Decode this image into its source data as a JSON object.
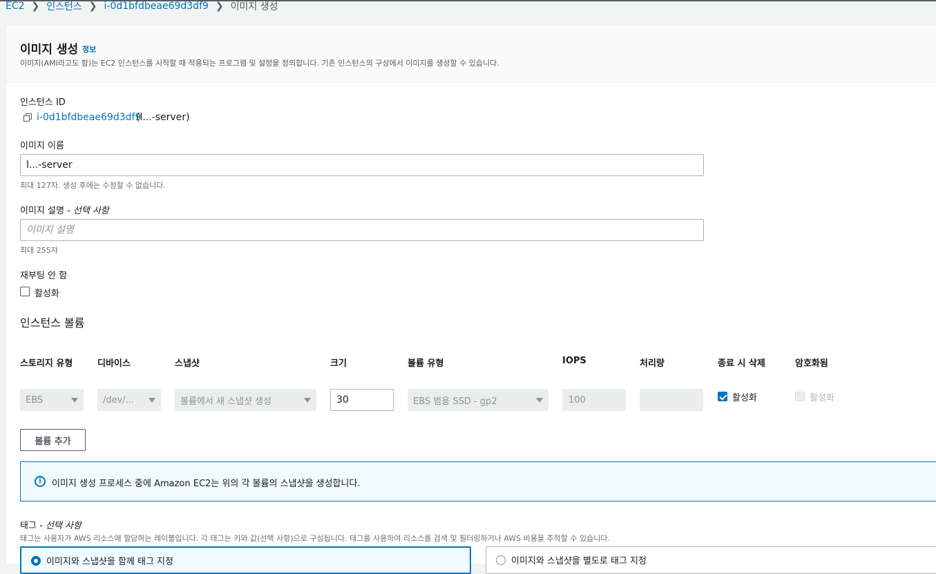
{
  "breadcrumb": {
    "items": [
      "EC2",
      "인스턴스",
      "i-0d1bfdbeae69d3df9"
    ],
    "current": "이미지 생성"
  },
  "header": {
    "title": "이미지 생성",
    "info_link": "정보",
    "description": "이미지(AMI라고도 함)는 EC2 인스턴스를 시작할 때 적용되는 프로그램 및 설정을 정의합니다. 기존 인스턴스의 구성에서 이미지를 생성할 수 있습니다."
  },
  "instance": {
    "label": "인스턴스 ID",
    "id": "i-0d1bfdbeae69d3df9",
    "name": "(l...-server)"
  },
  "image_name": {
    "label": "이미지 이름",
    "value": "l...-server",
    "hint": "최대 127자. 생성 후에는 수정할 수 없습니다."
  },
  "image_description": {
    "label": "이미지 설명",
    "optional": "- 선택 사항",
    "placeholder": "이미지 설명",
    "hint": "최대 255자"
  },
  "no_reboot": {
    "label": "재부팅 안 함",
    "checkbox_label": "활성화",
    "checked": false
  },
  "volumes": {
    "title": "인스턴스 볼륨",
    "columns": [
      "스토리지 유형",
      "디바이스",
      "스냅샷",
      "크기",
      "볼륨 유형",
      "IOPS",
      "처리량",
      "종료 시 삭제",
      "암호화됨"
    ],
    "row": {
      "storage_type": "EBS",
      "device": "/dev/...",
      "snapshot": "볼륨에서 새 스냅샷 생성",
      "size": "30",
      "volume_type": "EBS 범용 SSD - gp2",
      "iops": "100",
      "throughput": "",
      "delete_on_termination": "활성화",
      "encrypted": "활성화"
    },
    "add_button": "볼륨 추가"
  },
  "alert": {
    "icon": "info-icon",
    "text": "이미지 생성 프로세스 중에 Amazon EC2는 위의 각 볼륨의 스냅샷을 생성합니다."
  },
  "tags": {
    "label": "태그",
    "optional": "- 선택 사항",
    "description": "태그는 사용자가 AWS 리소스에 할당하는 레이블입니다. 각 태그는 키와 값(선택 사항)으로 구성됩니다. 태그를 사용하여 리소스를 검색 및 필터링하거나 AWS 비용을 추적할 수 있습니다.",
    "option_together": "이미지와 스냅샷을 함께 태그 지정",
    "option_separate": "이미지와 스냅샷을 별도로 태그 지정"
  },
  "colors": {
    "link": "#0073bb",
    "text": "#16191f",
    "muted": "#545b64",
    "disabled_bg": "#eaeded"
  }
}
